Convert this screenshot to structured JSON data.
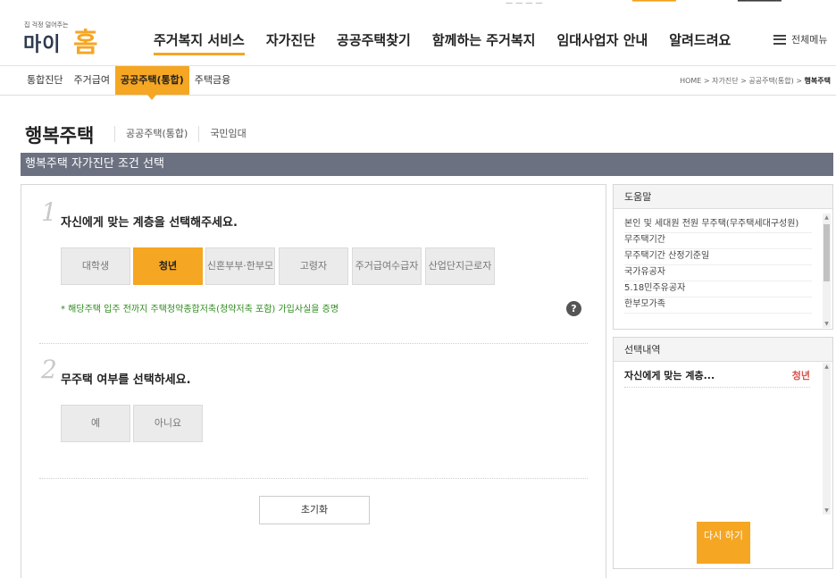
{
  "logo": {
    "tagline": "집 걱정 덜어주는",
    "name_part1": "마이",
    "name_part2": "홈"
  },
  "gnb": {
    "items": [
      {
        "label": "주거복지 서비스"
      },
      {
        "label": "자가진단"
      },
      {
        "label": "공공주택찾기"
      },
      {
        "label": "함께하는 주거복지"
      },
      {
        "label": "임대사업자 안내"
      },
      {
        "label": "알려드려요"
      }
    ],
    "all_menu": "전체메뉴"
  },
  "lnb": {
    "items": [
      {
        "label": "통합진단"
      },
      {
        "label": "주거급여"
      },
      {
        "label": "공공주택(통합)"
      },
      {
        "label": "주택금융"
      }
    ]
  },
  "breadcrumb": {
    "path": "HOME > 자가진단 > 공공주택(통합) > ",
    "current": "행복주택"
  },
  "page": {
    "title": "행복주택",
    "subtabs": [
      {
        "label": "공공주택(통합)"
      },
      {
        "label": "국민임대"
      }
    ],
    "section_bar": "행복주택 자가진단 조건 선택"
  },
  "q1": {
    "num": "1",
    "text": "자신에게 맞는 계층을 선택해주세요.",
    "options": [
      {
        "label": "대학생"
      },
      {
        "label": "청년"
      },
      {
        "label": "신혼부부·한부모"
      },
      {
        "label": "고령자"
      },
      {
        "label": "주거급여수급자"
      },
      {
        "label": "산업단지근로자"
      }
    ],
    "selected": "청년",
    "note": "* 해당주택 입주 전까지 주택청약종합저축(청약저축 포함) 가입사실을 증명",
    "help_icon": "?"
  },
  "q2": {
    "num": "2",
    "text": "무주택 여부를 선택하세요.",
    "options": [
      {
        "label": "예"
      },
      {
        "label": "아니요"
      }
    ]
  },
  "reset_label": "초기화",
  "help": {
    "title": "도움말",
    "items": [
      {
        "label": "본인 및 세대원 전원 무주택(무주택세대구성원)"
      },
      {
        "label": "무주택기간"
      },
      {
        "label": "무주택기간 산정기준일"
      },
      {
        "label": "국가유공자"
      },
      {
        "label": "5.18민주유공자"
      },
      {
        "label": "한부모가족"
      }
    ]
  },
  "selection": {
    "title": "선택내역",
    "rows": [
      {
        "key": "자신에게 맞는 계층...",
        "value": "청년"
      }
    ],
    "again_label": "다시 하기"
  },
  "colors": {
    "accent": "#f5a623",
    "bar": "#6b7180",
    "selected_value": "#d9534f",
    "note": "#2e8b1e"
  }
}
